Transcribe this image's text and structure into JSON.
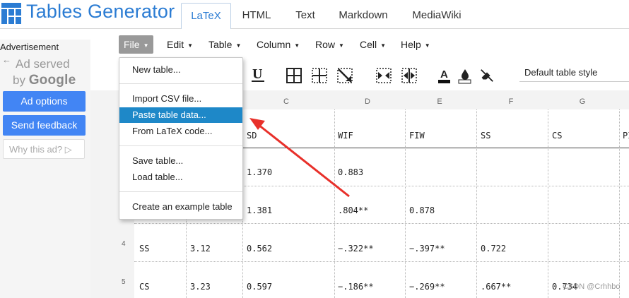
{
  "app": {
    "title": "Tables Generator"
  },
  "tabs": [
    {
      "label": "LaTeX",
      "active": true
    },
    {
      "label": "HTML"
    },
    {
      "label": "Markdown"
    },
    {
      "label": "MediaWiki"
    }
  ],
  "ad": {
    "label": "Advertisement",
    "served_line1": "Ad served",
    "served_by": "by",
    "google": "Google",
    "options_button": "Ad options",
    "feedback_button": "Send feedback",
    "why_button": "Why this ad?"
  },
  "menubar": {
    "items": [
      "File",
      "Edit",
      "Table",
      "Column",
      "Row",
      "Cell",
      "Help"
    ]
  },
  "file_menu": {
    "items": [
      "New table...",
      "Import CSV file...",
      "Paste table data...",
      "From LaTeX code...",
      "Save table...",
      "Load table...",
      "Create an example table"
    ],
    "highlighted": "Paste table data..."
  },
  "toolbar": {
    "icons": [
      "underline-icon",
      "all-borders-icon",
      "inner-borders-icon",
      "remove-borders-icon",
      "merge-cells-icon",
      "split-cells-icon",
      "text-color-icon",
      "fill-color-icon",
      "clear-format-icon"
    ],
    "style_select": "Default table style"
  },
  "grid": {
    "column_headers": [
      "C",
      "D",
      "E",
      "F",
      "G"
    ],
    "row_numbers": [
      "4",
      "5"
    ],
    "rows": [
      [
        "",
        "",
        "SD",
        "WIF",
        "FIW",
        "SS",
        "CS",
        "PI"
      ],
      [
        "",
        "",
        "1.370",
        "0.883",
        "",
        "",
        "",
        ""
      ],
      [
        "",
        "",
        "1.381",
        ".804**",
        "0.878",
        "",
        "",
        ""
      ],
      [
        "SS",
        "3.12",
        "0.562",
        "−.322**",
        "−.397**",
        "0.722",
        "",
        ""
      ],
      [
        "CS",
        "3.23",
        "0.597",
        "−.186**",
        "−.269**",
        ".667**",
        "0.734",
        ""
      ]
    ]
  },
  "watermark": "CSDN @Crhhbo",
  "colors": {
    "brand": "#2b7cd3",
    "menu_highlight": "#1e88c8",
    "ad_button": "#4285f4",
    "arrow": "#e8302a"
  }
}
